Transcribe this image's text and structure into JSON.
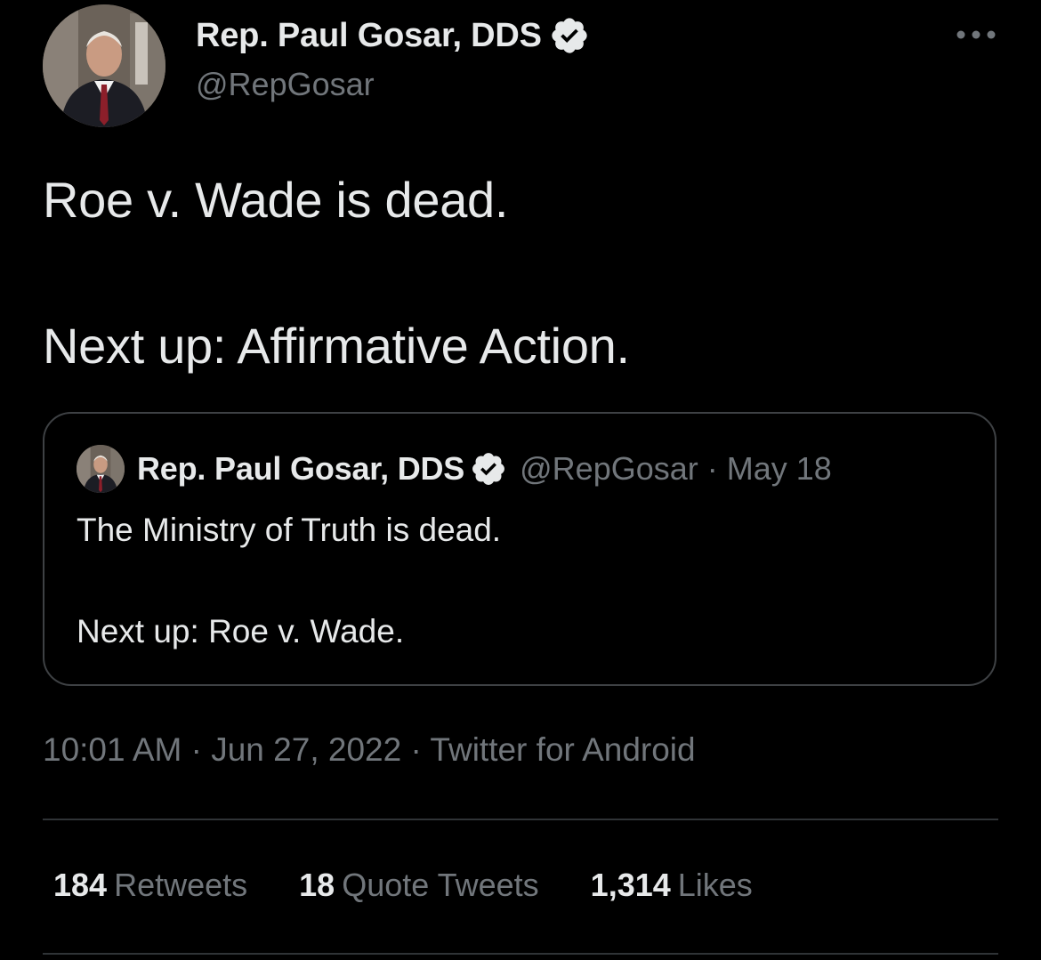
{
  "author": {
    "name": "Rep. Paul Gosar, DDS",
    "handle": "@RepGosar"
  },
  "tweet": {
    "line1": "Roe v. Wade is dead.",
    "line2": "Next up: Affirmative Action."
  },
  "quote": {
    "name": "Rep. Paul Gosar, DDS",
    "handle": "@RepGosar",
    "separator": "·",
    "date": "May 18",
    "line1": "The Ministry of Truth is dead.",
    "line2": "Next up: Roe v. Wade."
  },
  "meta": {
    "time": "10:01 AM",
    "date": "Jun 27, 2022",
    "source": "Twitter for Android",
    "separator": "·"
  },
  "stats": {
    "retweets_count": "184",
    "retweets_label": "Retweets",
    "quotes_count": "18",
    "quotes_label": "Quote Tweets",
    "likes_count": "1,314",
    "likes_label": "Likes"
  },
  "icons": {
    "verified": "verified-badge-icon",
    "more": "more-horizontal-icon"
  },
  "colors": {
    "background": "#000000",
    "text_primary": "#e7e9ea",
    "text_secondary": "#71767b",
    "border": "#3e4144"
  }
}
